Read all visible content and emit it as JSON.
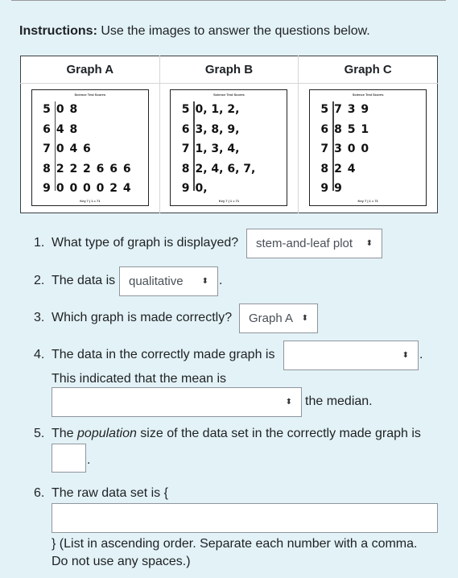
{
  "instructions": {
    "label": "Instructions:",
    "text": " Use the images to answer the questions below."
  },
  "graphs": [
    {
      "header": "Graph A",
      "title": "Science Test Scores",
      "key": "Key 7 | 1 = 71",
      "rows": [
        {
          "stem": "5",
          "leaves": "0 8"
        },
        {
          "stem": "6",
          "leaves": "4 8"
        },
        {
          "stem": "7",
          "leaves": "0 4 6"
        },
        {
          "stem": "8",
          "leaves": "2 2 2 6 6 6"
        },
        {
          "stem": "9",
          "leaves": "0 0 0 0 2 4"
        }
      ]
    },
    {
      "header": "Graph B",
      "title": "Science Test Scores",
      "key": "Key 7 | 1 = 71",
      "rows": [
        {
          "stem": "5",
          "leaves": "0, 1, 2,"
        },
        {
          "stem": "6",
          "leaves": "3, 8, 9,"
        },
        {
          "stem": "7",
          "leaves": "1, 3, 4,"
        },
        {
          "stem": "8",
          "leaves": "2, 4, 6, 7,"
        },
        {
          "stem": "9",
          "leaves": "0,"
        }
      ]
    },
    {
      "header": "Graph C",
      "title": "Science Test Scores",
      "key": "Key 7 | 1 = 71",
      "rows": [
        {
          "stem": "5",
          "leaves": "7 3 9"
        },
        {
          "stem": "6",
          "leaves": "8 5 1"
        },
        {
          "stem": "7",
          "leaves": "3 0 0"
        },
        {
          "stem": "8",
          "leaves": "2 4"
        },
        {
          "stem": "9",
          "leaves": "9"
        }
      ]
    }
  ],
  "questions": {
    "q1": {
      "num": "1.",
      "text": "What type of graph is displayed?",
      "selected": "stem-and-leaf plot"
    },
    "q2": {
      "num": "2.",
      "text": "The data is",
      "selected": "qualitative",
      "after": "."
    },
    "q3": {
      "num": "3.",
      "text": "Which graph is made correctly?",
      "selected": "Graph A"
    },
    "q4": {
      "num": "4.",
      "text": "The data in the correctly made graph is",
      "selected1": "",
      "after1": ".",
      "text2": "This indicated that the mean is",
      "selected2": "",
      "after2": "the median."
    },
    "q5": {
      "num": "5.",
      "text_pre": "The ",
      "text_em": "population",
      "text_post": " size of the data set in the correctly made graph is",
      "value": "",
      "after": "."
    },
    "q6": {
      "num": "6.",
      "text": "The raw data set is {",
      "value": "",
      "after1": "} (List in ascending order. Separate each number with a comma.",
      "after2": "Do not use any spaces.)"
    }
  },
  "icons": {
    "select_arrow": "⬍"
  }
}
